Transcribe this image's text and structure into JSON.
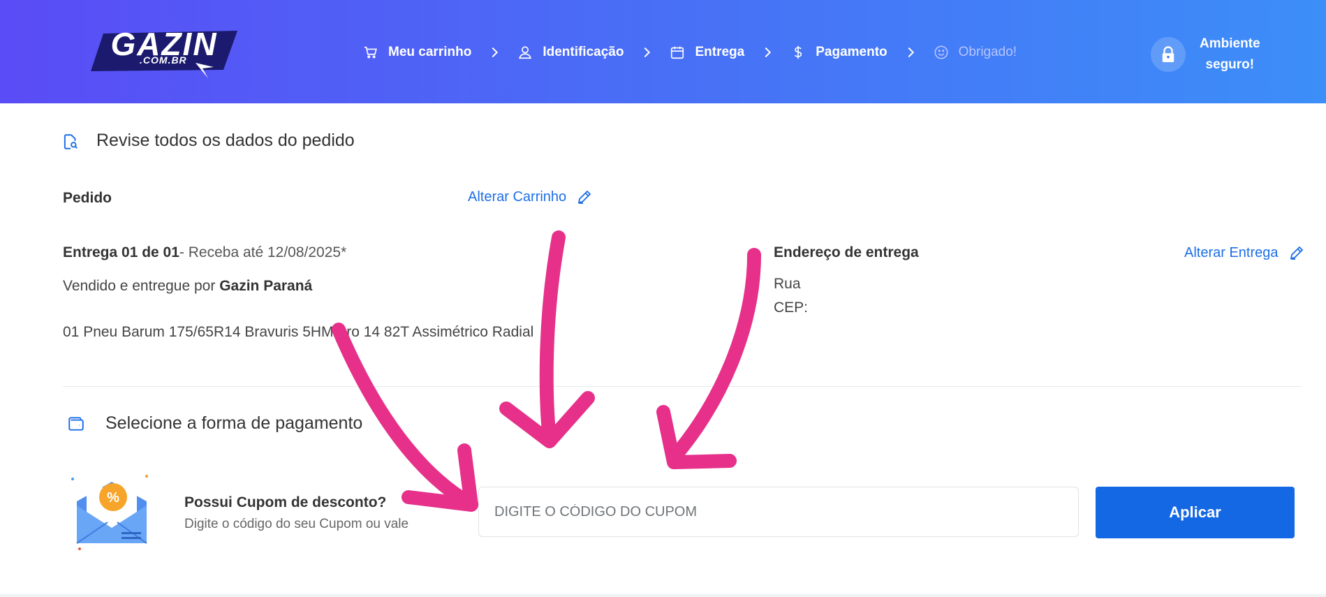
{
  "header": {
    "logo_text": "GAZIN",
    "logo_sub": ".COM.BR",
    "steps": [
      {
        "label": "Meu carrinho",
        "icon": "cart-icon"
      },
      {
        "label": "Identificação",
        "icon": "user-icon"
      },
      {
        "label": "Entrega",
        "icon": "calendar-icon"
      },
      {
        "label": "Pagamento",
        "icon": "dollar-icon"
      },
      {
        "label": "Obrigado!",
        "icon": "smile-icon"
      }
    ],
    "secure_line1": "Ambiente",
    "secure_line2": "seguro!"
  },
  "review": {
    "title": "Revise todos os dados do pedido",
    "order_label": "Pedido",
    "change_cart": "Alterar Carrinho",
    "delivery_label": "Entrega 01 de 01",
    "delivery_date": "- Receba até 12/08/2025*",
    "sold_by_prefix": "Vendido e entregue por ",
    "sold_by_name": "Gazin Paraná",
    "product": "01 Pneu Barum 175/65R14 Bravuris 5HM Aro 14 82T Assimétrico Radial",
    "address_label": "Endereço de entrega",
    "change_delivery": "Alterar Entrega",
    "address_street": "Rua",
    "address_cep": "CEP:"
  },
  "payment": {
    "title": "Selecione a forma de pagamento",
    "coupon_title": "Possui Cupom de desconto?",
    "coupon_sub": "Digite o código do seu Cupom ou vale",
    "coupon_placeholder": "DIGITE O CÓDIGO DO CUPOM",
    "apply_label": "Aplicar"
  },
  "colors": {
    "accent": "#1468e3",
    "arrow": "#e6308a"
  }
}
